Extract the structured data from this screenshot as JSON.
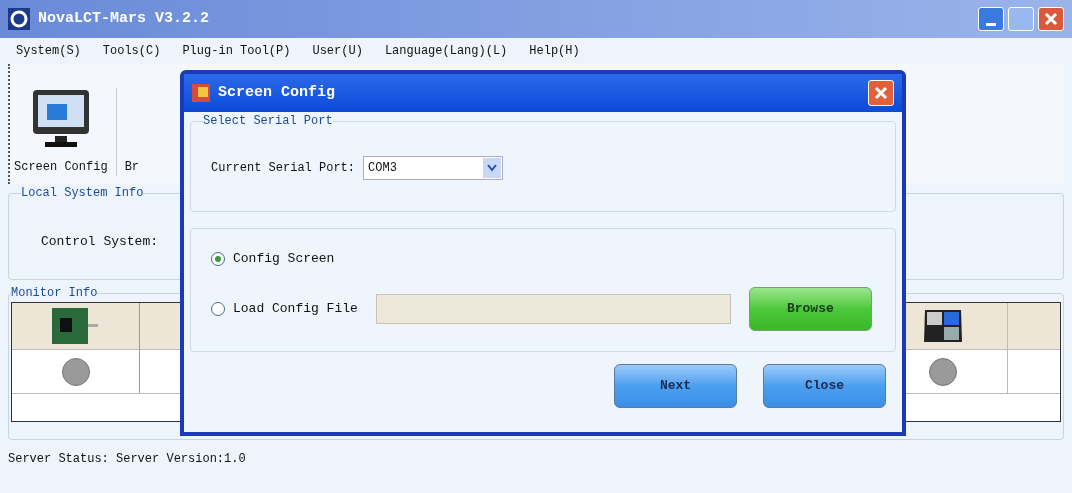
{
  "window": {
    "title": "NovaLCT-Mars V3.2.2"
  },
  "menu": [
    "System(S)",
    "Tools(C)",
    "Plug-in Tool(P)",
    "User(U)",
    "Language(Lang)(L)",
    "Help(H)"
  ],
  "toolbar": [
    {
      "label": "Screen Config"
    },
    {
      "label": "Br"
    }
  ],
  "local_system_info": {
    "title": "Local System Info",
    "label": "Control System:"
  },
  "monitor_info": {
    "title": "Monitor Info"
  },
  "status_bar": "Server Status: Server Version:1.0",
  "dialog": {
    "title": "Screen Config",
    "serial_group": {
      "title": "Select Serial Port",
      "label": "Current Serial Port:",
      "value": "COM3"
    },
    "options": [
      {
        "label": "Config Screen",
        "selected": true
      },
      {
        "label": "Load Config File",
        "selected": false
      }
    ],
    "browse": "Browse",
    "buttons": [
      "Next",
      "Close"
    ]
  }
}
